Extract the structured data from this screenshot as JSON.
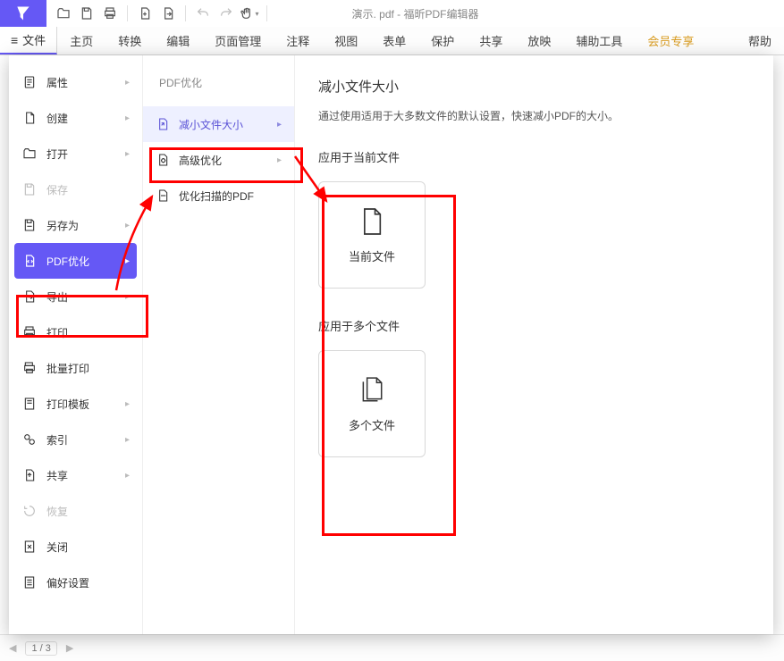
{
  "app": {
    "doc_title": "演示. pdf - 福昕PDF编辑器"
  },
  "tabs": {
    "file": "文件",
    "items": [
      "主页",
      "转换",
      "编辑",
      "页面管理",
      "注释",
      "视图",
      "表单",
      "保护",
      "共享",
      "放映",
      "辅助工具",
      "会员专享",
      "帮助"
    ]
  },
  "file_menu": {
    "items": [
      {
        "label": "属性",
        "has_sub": true
      },
      {
        "label": "创建",
        "has_sub": true
      },
      {
        "label": "打开",
        "has_sub": true
      },
      {
        "label": "保存",
        "disabled": true
      },
      {
        "label": "另存为",
        "has_sub": true
      },
      {
        "label": "PDF优化",
        "has_sub": true,
        "selected": true
      },
      {
        "label": "导出",
        "has_sub": true
      },
      {
        "label": "打印"
      },
      {
        "label": "批量打印"
      },
      {
        "label": "打印模板",
        "has_sub": true
      },
      {
        "label": "索引",
        "has_sub": true
      },
      {
        "label": "共享",
        "has_sub": true
      },
      {
        "label": "恢复",
        "disabled": true
      },
      {
        "label": "关闭"
      },
      {
        "label": "偏好设置"
      }
    ]
  },
  "optimize_submenu": {
    "heading": "PDF优化",
    "items": [
      {
        "label": "减小文件大小",
        "active": true
      },
      {
        "label": "高级优化"
      },
      {
        "label": "优化扫描的PDF"
      }
    ]
  },
  "detail": {
    "title": "减小文件大小",
    "desc": "通过使用适用于大多数文件的默认设置，快速减小PDF的大小。",
    "section_current": "应用于当前文件",
    "card_current": "当前文件",
    "section_multi": "应用于多个文件",
    "card_multi": "多个文件"
  },
  "status": {
    "page": "1 / 3"
  }
}
